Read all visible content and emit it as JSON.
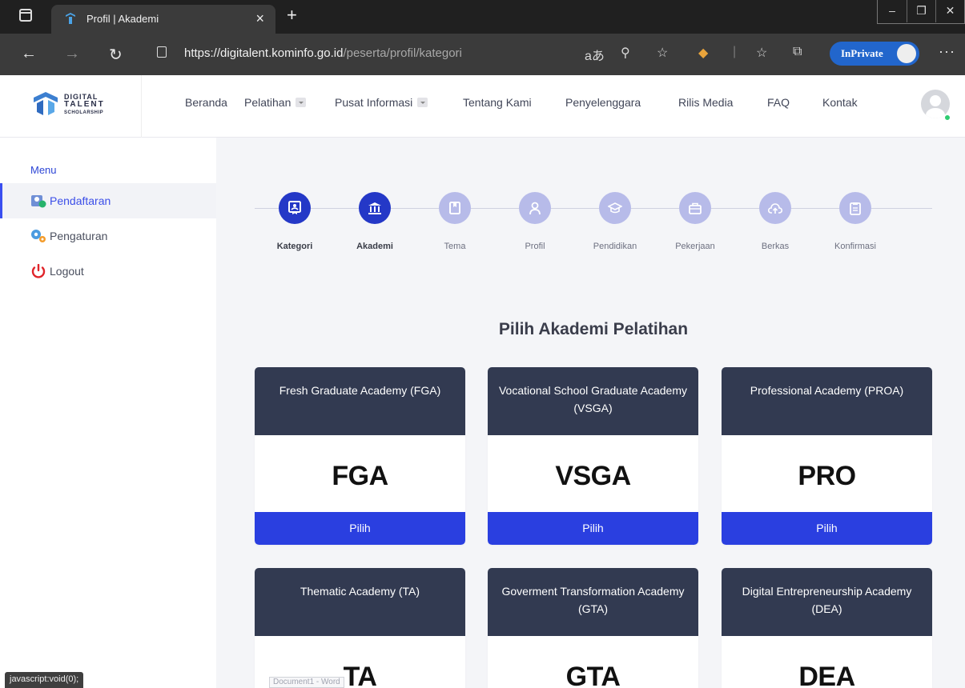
{
  "browser": {
    "tab_title": "Profil | Akademi",
    "url_domain": "https://digitalent.kominfo.go.id",
    "url_path": "/peserta/profil/kategori",
    "inprivate_label": "InPrivate",
    "status_text": "javascript:void(0);"
  },
  "site": {
    "logo_line1": "DIGITAL",
    "logo_line2": "TALENT",
    "logo_line3": "SCHOLARSHIP",
    "nav": [
      {
        "label": "Beranda"
      },
      {
        "label": "Pelatihan"
      },
      {
        "label": "Pusat Informasi"
      },
      {
        "label": "Tentang Kami"
      },
      {
        "label": "Penyelenggara"
      },
      {
        "label": "Rilis Media"
      },
      {
        "label": "FAQ"
      },
      {
        "label": "Kontak"
      }
    ]
  },
  "sidebar": {
    "heading": "Menu",
    "items": [
      {
        "label": "Pendaftaran",
        "icon": "registration-icon"
      },
      {
        "label": "Pengaturan",
        "icon": "settings-gears-icon"
      },
      {
        "label": "Logout",
        "icon": "power-icon"
      }
    ]
  },
  "stepper": {
    "steps": [
      {
        "label": "Kategori",
        "icon": "badge-icon",
        "done": true
      },
      {
        "label": "Akademi",
        "icon": "institution-icon",
        "done": true
      },
      {
        "label": "Tema",
        "icon": "book-icon",
        "done": false
      },
      {
        "label": "Profil",
        "icon": "person-icon",
        "done": false
      },
      {
        "label": "Pendidikan",
        "icon": "graduation-cap-icon",
        "done": false
      },
      {
        "label": "Pekerjaan",
        "icon": "briefcase-icon",
        "done": false
      },
      {
        "label": "Berkas",
        "icon": "upload-icon",
        "done": false
      },
      {
        "label": "Konfirmasi",
        "icon": "clipboard-icon",
        "done": false
      }
    ]
  },
  "main": {
    "title": "Pilih Akademi Pelatihan",
    "select_label": "Pilih",
    "academies": [
      {
        "name": "Fresh Graduate Academy (FGA)",
        "abbr": "FGA"
      },
      {
        "name": "Vocational School Graduate Academy (VSGA)",
        "abbr": "VSGA"
      },
      {
        "name": "Professional Academy (PROA)",
        "abbr": "PRO"
      },
      {
        "name": "Thematic Academy (TA)",
        "abbr": "TA"
      },
      {
        "name": "Goverment Transformation Academy (GTA)",
        "abbr": "GTA"
      },
      {
        "name": "Digital Entrepreneurship Academy (DEA)",
        "abbr": "DEA"
      }
    ]
  },
  "overlay": {
    "doc_tip": "Document1 - Word"
  },
  "colors": {
    "primary": "#2a3fe0",
    "card_header": "#323a51",
    "step_done": "#2438c7",
    "step_pending": "#b7bbe9"
  }
}
